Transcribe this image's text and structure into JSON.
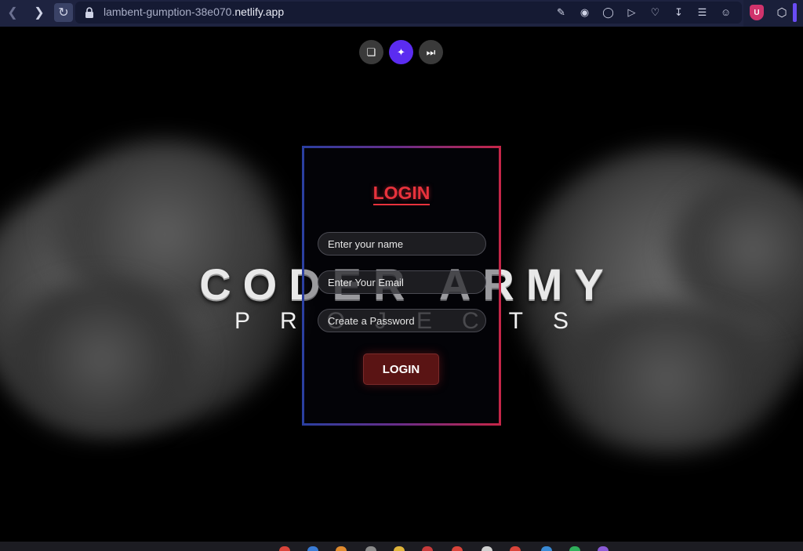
{
  "browser": {
    "url_prefix": "lambent-gumption-38e070.",
    "url_domain": "netlify.app",
    "toolbar_icons": [
      "edit-icon",
      "camera-icon",
      "shield-icon",
      "play-icon",
      "heart-icon",
      "download-icon",
      "menu-icon",
      "profile-icon"
    ],
    "extensions": {
      "shield_label": "U"
    }
  },
  "page": {
    "fab_buttons": [
      "copy-icon",
      "sparkle-icon",
      "skip-icon"
    ],
    "hero": {
      "title": "CODER ARMY",
      "subtitle": "PROJECTS"
    },
    "login": {
      "title": "LOGIN",
      "name_placeholder": "Enter your name",
      "email_placeholder": "Enter Your Email",
      "password_placeholder": "Create a Password",
      "button_label": "LOGIN"
    }
  },
  "colors": {
    "accent_red": "#e8323c",
    "button_bg": "#5a1414",
    "magic_fab": "#5b2cf0",
    "border_blue": "#2b3fa0",
    "border_red": "#c52648"
  }
}
